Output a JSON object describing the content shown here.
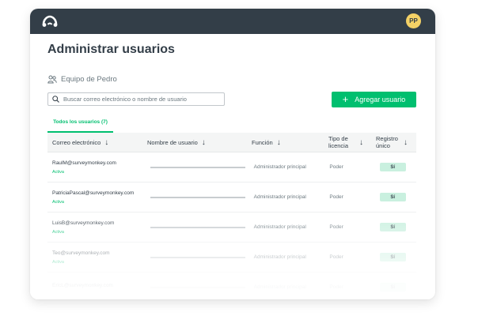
{
  "header": {
    "avatar_initials": "PP",
    "bar_color": "#333e48",
    "avatar_color": "#f4d166"
  },
  "page": {
    "title": "Administrar usuarios",
    "team_name": "Equipo de Pedro"
  },
  "search": {
    "placeholder": "Buscar correo electrónico o nombre de usuario"
  },
  "add_user_button": {
    "label": "Agregar usuario",
    "color": "#00bf6f"
  },
  "tabs": [
    {
      "label": "Todos los usuarios (7)",
      "active": true
    }
  ],
  "table": {
    "columns": [
      {
        "label": "Correo electrónico"
      },
      {
        "label": "Nombre de usuario"
      },
      {
        "label": "Función"
      },
      {
        "label": "Tipo de licencia"
      },
      {
        "label": "Registro único"
      }
    ],
    "rows": [
      {
        "email": "RaulM@surveymonkey.com",
        "status": "Activa",
        "role": "Administrador principal",
        "license": "Poder",
        "sso": "Sí"
      },
      {
        "email": "PatriciaPascal@surveymonkey.com",
        "status": "Activa",
        "role": "Administrador principal",
        "license": "Poder",
        "sso": "Sí"
      },
      {
        "email": "LuisB@surveymonkey.com",
        "status": "Activa",
        "role": "Administrador principal",
        "license": "Poder",
        "sso": "Sí"
      },
      {
        "email": "Teo@surveymonkey.com",
        "status": "Activa",
        "role": "Administrador principal",
        "license": "Poder",
        "sso": "Sí"
      },
      {
        "email": "EricL@surveymonkey.com",
        "status": "",
        "role": "Administrador principal",
        "license": "Poder",
        "sso": "Sí"
      }
    ]
  }
}
